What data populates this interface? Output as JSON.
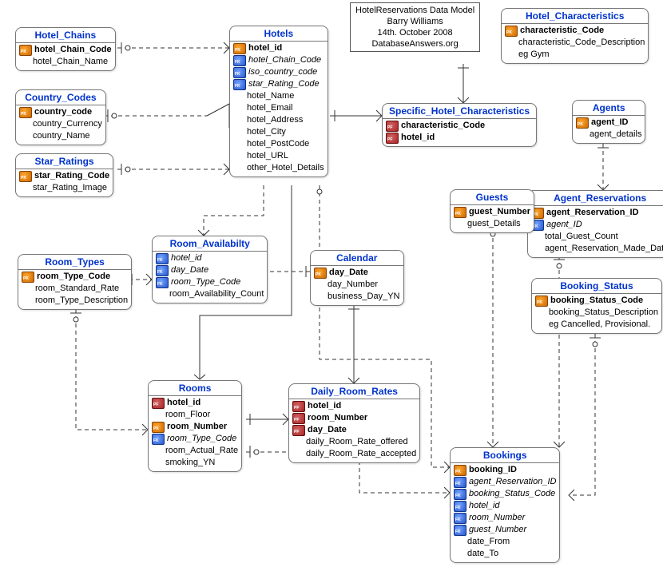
{
  "diagram_title": {
    "line1": "HotelReservations Data Model",
    "line2": "Barry Williams",
    "line3": "14th. October 2008",
    "line4": "DatabaseAnswers.org"
  },
  "entities": {
    "hotel_chains": {
      "title": "Hotel_Chains",
      "cols": [
        {
          "key": "pk",
          "name": "hotel_Chain_Code",
          "bold": true
        },
        {
          "key": "",
          "name": "hotel_Chain_Name"
        }
      ]
    },
    "country_codes": {
      "title": "Country_Codes",
      "cols": [
        {
          "key": "pk",
          "name": "country_code",
          "bold": true
        },
        {
          "key": "",
          "name": "country_Currency"
        },
        {
          "key": "",
          "name": "country_Name"
        }
      ]
    },
    "star_ratings": {
      "title": "Star_Ratings",
      "cols": [
        {
          "key": "pk",
          "name": "star_Rating_Code",
          "bold": true
        },
        {
          "key": "",
          "name": "star_Rating_Image"
        }
      ]
    },
    "hotels": {
      "title": "Hotels",
      "cols": [
        {
          "key": "pk",
          "name": "hotel_id",
          "bold": true
        },
        {
          "key": "fk",
          "name": "hotel_Chain_Code",
          "italic": true
        },
        {
          "key": "fk",
          "name": "iso_country_code",
          "italic": true
        },
        {
          "key": "fk",
          "name": "star_Rating_Code",
          "italic": true
        },
        {
          "key": "",
          "name": "hotel_Name"
        },
        {
          "key": "",
          "name": "hotel_Email"
        },
        {
          "key": "",
          "name": "hotel_Address"
        },
        {
          "key": "",
          "name": "hotel_City"
        },
        {
          "key": "",
          "name": "hotel_PostCode"
        },
        {
          "key": "",
          "name": "hotel_URL"
        },
        {
          "key": "",
          "name": "other_Hotel_Details"
        }
      ]
    },
    "specific_hotel_characteristics": {
      "title": "Specific_Hotel_Characteristics",
      "cols": [
        {
          "key": "pf",
          "name": "characteristic_Code",
          "bold": true
        },
        {
          "key": "pf",
          "name": "hotel_id",
          "bold": true
        }
      ]
    },
    "hotel_characteristics": {
      "title": "Hotel_Characteristics",
      "cols": [
        {
          "key": "pk",
          "name": "characteristic_Code",
          "bold": true
        },
        {
          "key": "",
          "name": "characteristic_Code_Description"
        },
        {
          "key": "",
          "name": "eg Gym"
        }
      ]
    },
    "agents": {
      "title": "Agents",
      "cols": [
        {
          "key": "pk",
          "name": "agent_ID",
          "bold": true
        },
        {
          "key": "",
          "name": "agent_details"
        }
      ]
    },
    "agent_reservations": {
      "title": "Agent_Reservations",
      "cols": [
        {
          "key": "pk",
          "name": "agent_Reservation_ID",
          "bold": true
        },
        {
          "key": "fk",
          "name": "agent_ID",
          "italic": true
        },
        {
          "key": "",
          "name": "total_Guest_Count"
        },
        {
          "key": "",
          "name": "agent_Reservation_Made_Date"
        }
      ]
    },
    "guests": {
      "title": "Guests",
      "cols": [
        {
          "key": "pk",
          "name": "guest_Number",
          "bold": true
        },
        {
          "key": "",
          "name": "guest_Details"
        }
      ]
    },
    "booking_status": {
      "title": "Booking_Status",
      "cols": [
        {
          "key": "pk",
          "name": "booking_Status_Code",
          "bold": true
        },
        {
          "key": "",
          "name": "booking_Status_Description"
        },
        {
          "key": "",
          "name": "eg Cancelled, Provisional."
        }
      ]
    },
    "room_types": {
      "title": "Room_Types",
      "cols": [
        {
          "key": "pk",
          "name": "room_Type_Code",
          "bold": true
        },
        {
          "key": "",
          "name": "room_Standard_Rate"
        },
        {
          "key": "",
          "name": "room_Type_Description"
        }
      ]
    },
    "room_availability": {
      "title": "Room_Availabilty",
      "cols": [
        {
          "key": "fk",
          "name": "hotel_id",
          "italic": true
        },
        {
          "key": "fk",
          "name": "day_Date",
          "italic": true
        },
        {
          "key": "fk",
          "name": "room_Type_Code",
          "italic": true
        },
        {
          "key": "",
          "name": "room_Availability_Count"
        }
      ]
    },
    "calendar": {
      "title": "Calendar",
      "cols": [
        {
          "key": "pk",
          "name": "day_Date",
          "bold": true
        },
        {
          "key": "",
          "name": "day_Number"
        },
        {
          "key": "",
          "name": "business_Day_YN"
        }
      ]
    },
    "rooms": {
      "title": "Rooms",
      "cols": [
        {
          "key": "pf",
          "name": "hotel_id",
          "bold": true
        },
        {
          "key": "",
          "name": "room_Floor"
        },
        {
          "key": "pk",
          "name": "room_Number",
          "bold": true
        },
        {
          "key": "fk",
          "name": "room_Type_Code",
          "italic": true
        },
        {
          "key": "",
          "name": "room_Actual_Rate"
        },
        {
          "key": "",
          "name": "smoking_YN"
        }
      ]
    },
    "daily_room_rates": {
      "title": "Daily_Room_Rates",
      "cols": [
        {
          "key": "pf",
          "name": "hotel_id",
          "bold": true
        },
        {
          "key": "pf",
          "name": "room_Number",
          "bold": true
        },
        {
          "key": "pf",
          "name": "day_Date",
          "bold": true
        },
        {
          "key": "",
          "name": "daily_Room_Rate_offered"
        },
        {
          "key": "",
          "name": "daily_Room_Rate_accepted"
        }
      ]
    },
    "bookings": {
      "title": "Bookings",
      "cols": [
        {
          "key": "pk",
          "name": "booking_ID",
          "bold": true
        },
        {
          "key": "fk",
          "name": "agent_Reservation_ID",
          "italic": true
        },
        {
          "key": "fk",
          "name": "booking_Status_Code",
          "italic": true
        },
        {
          "key": "fk",
          "name": "hotel_id",
          "italic": true
        },
        {
          "key": "fk",
          "name": "room_Number",
          "italic": true
        },
        {
          "key": "fk",
          "name": "guest_Number",
          "italic": true
        },
        {
          "key": "",
          "name": "date_From"
        },
        {
          "key": "",
          "name": "date_To"
        }
      ]
    }
  }
}
